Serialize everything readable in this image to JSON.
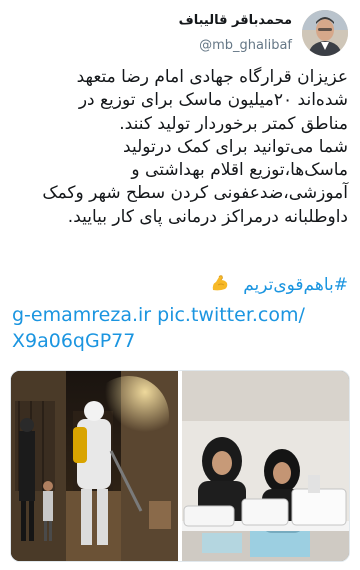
{
  "tweet": {
    "display_name": "محمدباقر قالیباف",
    "handle": "@mb_ghalibaf",
    "body_lines": [
      "عزیزان قرارگاه جهادی امام رضا متعهد",
      "شده‌اند ۲۰میلیون ماسک برای توزیع در",
      "مناطق کمتر برخوردار تولید کنند.",
      "شما می‌توانید برای کمک درتولید",
      "ماسک‌ها،توزیع اقلام بهداشتی و",
      "آموزشی،ضدعفونی کردن سطح شهر وکمک",
      "داوطلبانه درمراکز درمانی پای کار بیایید."
    ],
    "hashtag": "#باهم‌قوی‌تریم",
    "emoji_icon": "flexed-biceps-icon",
    "link_line_1": "g-emamreza.ir pic.twitter.com/",
    "link_line_2": "X9a06qGP77",
    "media": {
      "photo_left": "night-alley-disinfection-photo",
      "photo_right": "mask-sewing-workshop-photo"
    },
    "colors": {
      "link": "#1b95e0",
      "text": "#14171a",
      "secondary": "#657786"
    }
  }
}
